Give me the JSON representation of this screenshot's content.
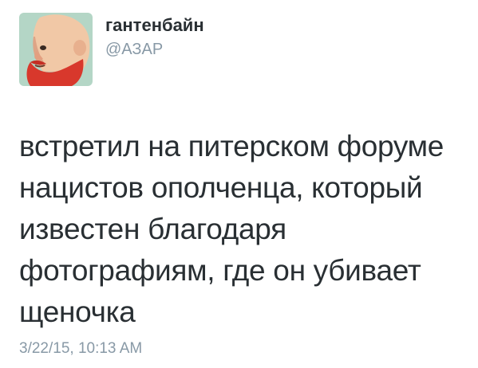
{
  "user": {
    "display_name": "гантенбайн",
    "handle": "@АЗАР",
    "avatar_icon": "red-bearded-man-avatar-icon"
  },
  "tweet": {
    "lines": [
      "встретил на питерском форуме",
      "нацистов ополченца, который",
      "известен благодаря",
      "фотографиям, где он убивает",
      "щеночка"
    ],
    "timestamp": "3/22/15, 10:13 AM"
  },
  "colors": {
    "avatar_background": "#b4d6c6",
    "avatar_beard": "#d8382c",
    "text": "#292f33",
    "secondary_text": "#8899a6"
  }
}
